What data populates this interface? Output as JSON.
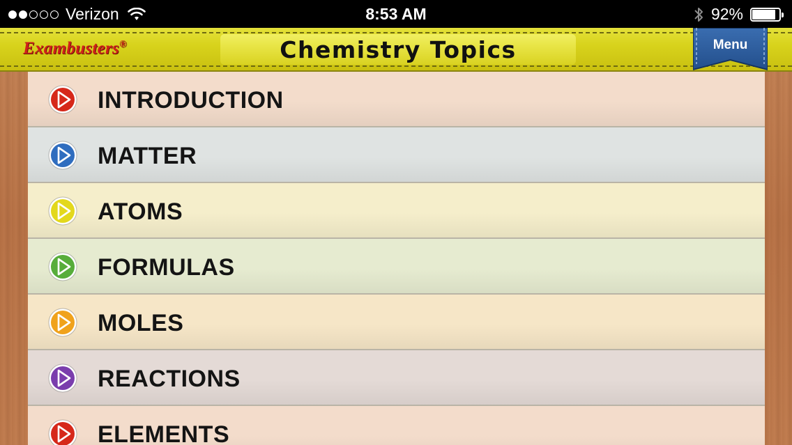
{
  "status_bar": {
    "carrier": "Verizon",
    "signal_bars_filled": 2,
    "signal_bars_total": 5,
    "time": "8:53 AM",
    "battery": "92%",
    "battery_level": 0.92
  },
  "header": {
    "brand": "Exambusters",
    "brand_mark": "®",
    "title": "Chemistry Topics",
    "menu_label": "Menu"
  },
  "colors": {
    "header_yellow": "#d8d31c",
    "ribbon_blue": "#2b5c9c",
    "brand_red": "#d0201a"
  },
  "topics": [
    {
      "label": "INTRODUCTION",
      "icon": "play-red-icon",
      "icon_color": "#d6281a",
      "row_color": "#f3dccb"
    },
    {
      "label": "MATTER",
      "icon": "play-blue-icon",
      "icon_color": "#2f6dbf",
      "row_color": "#dfe3e2"
    },
    {
      "label": "ATOMS",
      "icon": "play-yellow-icon",
      "icon_color": "#e3d81c",
      "row_color": "#f5eecb"
    },
    {
      "label": "FORMULAS",
      "icon": "play-green-icon",
      "icon_color": "#57ad3a",
      "row_color": "#e6ebd0"
    },
    {
      "label": "MOLES",
      "icon": "play-orange-icon",
      "icon_color": "#f0a21c",
      "row_color": "#f6e6c7"
    },
    {
      "label": "REACTIONS",
      "icon": "play-purple-icon",
      "icon_color": "#7a3dad",
      "row_color": "#e4dad6"
    },
    {
      "label": "ELEMENTS",
      "icon": "play-red-icon",
      "icon_color": "#d6281a",
      "row_color": "#f3dccb"
    }
  ]
}
